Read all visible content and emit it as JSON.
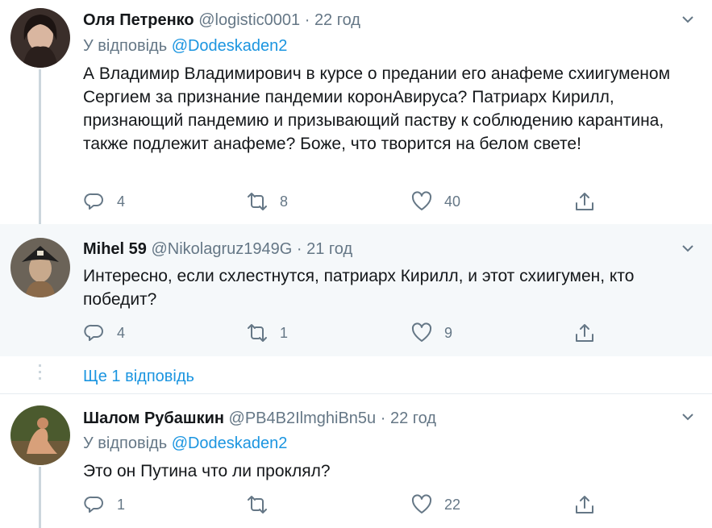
{
  "tweets": [
    {
      "name": "Оля Петренко",
      "handle": "@logistic0001",
      "separator": "·",
      "time": "22 год",
      "reply_prefix": "У відповідь",
      "reply_to": "@Dodeskaden2",
      "text": "А Владимир Владимирович в курсе о предании его анафеме схиигуменом Сергием за признание пандемии коронАвируса? Патриарх Кирилл, признающий пандемию и призывающий паству к соблюдению карантина, также подлежит анафеме? Боже, что творится на белом свете!",
      "replies": "4",
      "retweets": "8",
      "likes": "40"
    },
    {
      "name": "Mihel 59",
      "handle": "@Nikolagruz1949G",
      "separator": "·",
      "time": "21 год",
      "text": "Интересно, если схлестнутся, патриарх Кирилл, и этот схиигумен, кто победит?",
      "replies": "4",
      "retweets": "1",
      "likes": "9"
    },
    {
      "name": "Шалом Рубашкин",
      "handle": "@PB4B2IlmghiBn5u",
      "separator": "·",
      "time": "22 год",
      "reply_prefix": "У відповідь",
      "reply_to": "@Dodeskaden2",
      "text": "Это он Путина что ли проклял?",
      "replies": "1",
      "retweets": "",
      "likes": "22"
    }
  ],
  "more_replies_label": "Ще 1 відповідь",
  "colors": {
    "link": "#1b95e0",
    "secondary_text": "#657786",
    "highlight_bg": "#f5f8fa"
  },
  "icons": [
    "chevron-down-icon",
    "reply-icon",
    "retweet-icon",
    "like-icon",
    "share-icon"
  ]
}
